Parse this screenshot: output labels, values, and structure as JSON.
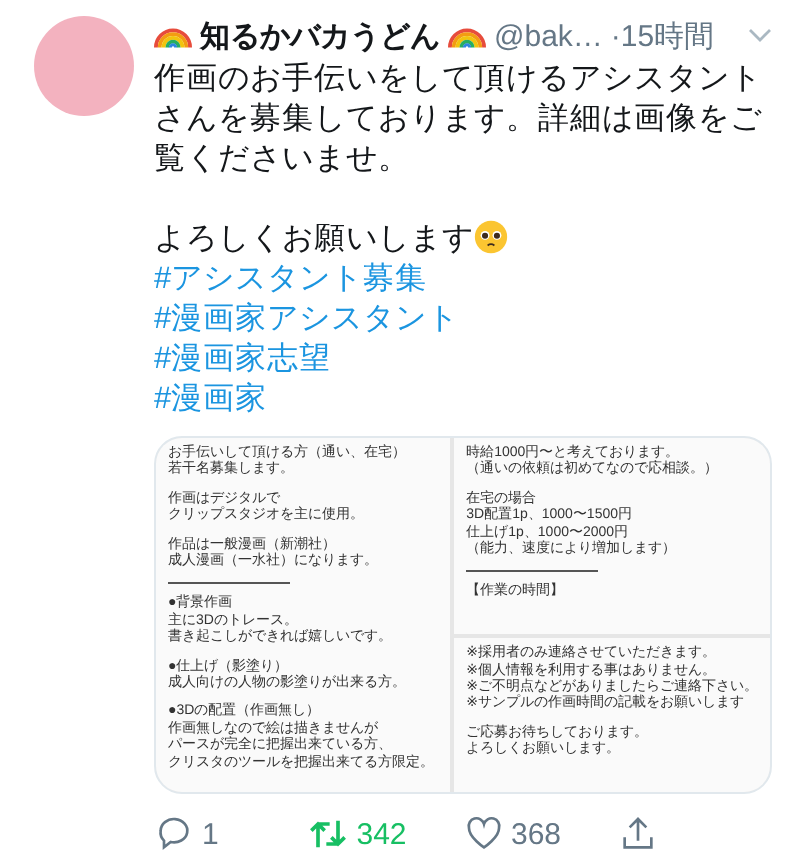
{
  "author": {
    "name": "知るかバカうどん",
    "handle": "@bak…",
    "time": "·15時間"
  },
  "body": {
    "paragraphs": [
      "作画のお手伝いをして頂けるアシスタントさんを募集しております。詳細は画像をご覧くださいませ。",
      "よろしくお願いします"
    ],
    "hashtags": [
      "#アシスタント募集",
      "#漫画家アシスタント",
      "#漫画家志望",
      "#漫画家"
    ]
  },
  "images": [
    {
      "blocks": [
        {
          "kind": "text",
          "lines": [
            "お手伝いして頂ける方（通い、在宅）",
            "若干名募集します。"
          ]
        },
        {
          "kind": "text",
          "lines": [
            "作画はデジタルで",
            "クリップスタジオを主に使用。"
          ]
        },
        {
          "kind": "text",
          "lines": [
            "作品は一般漫画（新潮社）",
            "成人漫画（一水社）になります。"
          ]
        },
        {
          "kind": "rule"
        },
        {
          "kind": "text",
          "lines": [
            "●背景作画",
            "主に3Dのトレース。",
            "書き起こしができれば嬉しいです。"
          ]
        },
        {
          "kind": "text",
          "lines": [
            "●仕上げ（影塗り）",
            "成人向けの人物の影塗りが出来る方。"
          ]
        },
        {
          "kind": "text",
          "lines": [
            "●3Dの配置（作画無し）",
            "作画無しなので絵は描きませんが",
            "パースが完全に把握出来ている方、",
            "クリスタのツールを把握出来てる方限定。"
          ]
        }
      ]
    },
    {
      "blocks": [
        {
          "kind": "text",
          "lines": [
            "時給1000円〜と考えております。",
            "（通いの依頼は初めてなので応相談。）"
          ]
        },
        {
          "kind": "text",
          "lines": [
            "在宅の場合",
            "3D配置1p、1000〜1500円",
            "仕上げ1p、1000〜2000円",
            "（能力、速度により増加します）"
          ]
        },
        {
          "kind": "rule"
        },
        {
          "kind": "text",
          "lines": [
            "【作業の時間】"
          ]
        }
      ]
    },
    {
      "blocks": [
        {
          "kind": "text",
          "lines": [
            "※採用者のみ連絡させていただきます。",
            "※個人情報を利用する事はありません。",
            "※ご不明点などがありましたらご連絡下さい。",
            "※サンプルの作画時間の記載をお願いします"
          ]
        },
        {
          "kind": "text",
          "lines": [
            "ご応募お待ちしております。",
            "よろしくお願いします。"
          ]
        }
      ]
    }
  ],
  "actions": [
    {
      "kind": "reply",
      "count": "1",
      "active": false
    },
    {
      "kind": "retweet",
      "count": "342",
      "active": true
    },
    {
      "kind": "like",
      "count": "368",
      "active": false
    },
    {
      "kind": "share"
    }
  ]
}
